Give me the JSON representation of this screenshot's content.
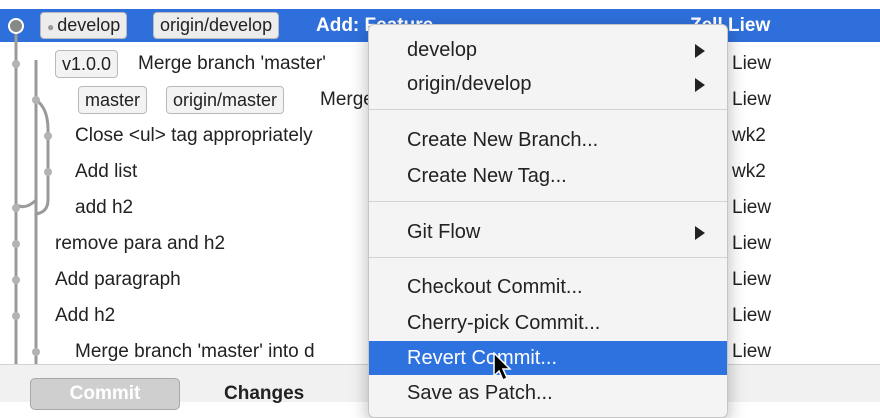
{
  "commits": [
    {
      "refs": [
        {
          "label": "develop",
          "dot": true
        },
        {
          "label": "origin/develop",
          "dot": false
        }
      ],
      "message": "Add: Feature",
      "author": "Zell Liew",
      "selected": true
    },
    {
      "refs": [
        {
          "label": "v1.0.0"
        }
      ],
      "message": "Merge branch 'master'",
      "author": "Liew"
    },
    {
      "refs": [
        {
          "label": "master"
        },
        {
          "label": "origin/master"
        }
      ],
      "message": "Merge",
      "author": "Liew"
    },
    {
      "refs": [],
      "message": "Close <ul> tag appropriately",
      "author": "wk2"
    },
    {
      "refs": [],
      "message": "Add list",
      "author": "wk2"
    },
    {
      "refs": [],
      "message": "add h2",
      "author": "Liew"
    },
    {
      "refs": [],
      "message": "remove para and h2",
      "author": "Liew"
    },
    {
      "refs": [],
      "message": "Add paragraph",
      "author": "Liew"
    },
    {
      "refs": [],
      "message": "Add h2",
      "author": "Liew"
    },
    {
      "refs": [],
      "message": "Merge branch 'master' into d",
      "author": "Liew"
    }
  ],
  "context_menu": {
    "items": [
      {
        "label": "develop",
        "submenu": true
      },
      {
        "label": "origin/develop",
        "submenu": true
      },
      {
        "separator": true
      },
      {
        "label": "Create New Branch...",
        "submenu": false
      },
      {
        "label": "Create New Tag...",
        "submenu": false
      },
      {
        "separator": true
      },
      {
        "label": "Git Flow",
        "submenu": true
      },
      {
        "separator": true
      },
      {
        "label": "Checkout Commit...",
        "submenu": false
      },
      {
        "label": "Cherry-pick Commit...",
        "submenu": false
      },
      {
        "label": "Revert Commit...",
        "submenu": false,
        "highlighted": true
      },
      {
        "label": "Save as Patch...",
        "submenu": false
      }
    ]
  },
  "bottom_bar": {
    "commit_label": "Commit",
    "changes_label": "Changes"
  },
  "colors": {
    "selection": "#2f6fdb",
    "menu_highlight": "#2e72e0"
  }
}
